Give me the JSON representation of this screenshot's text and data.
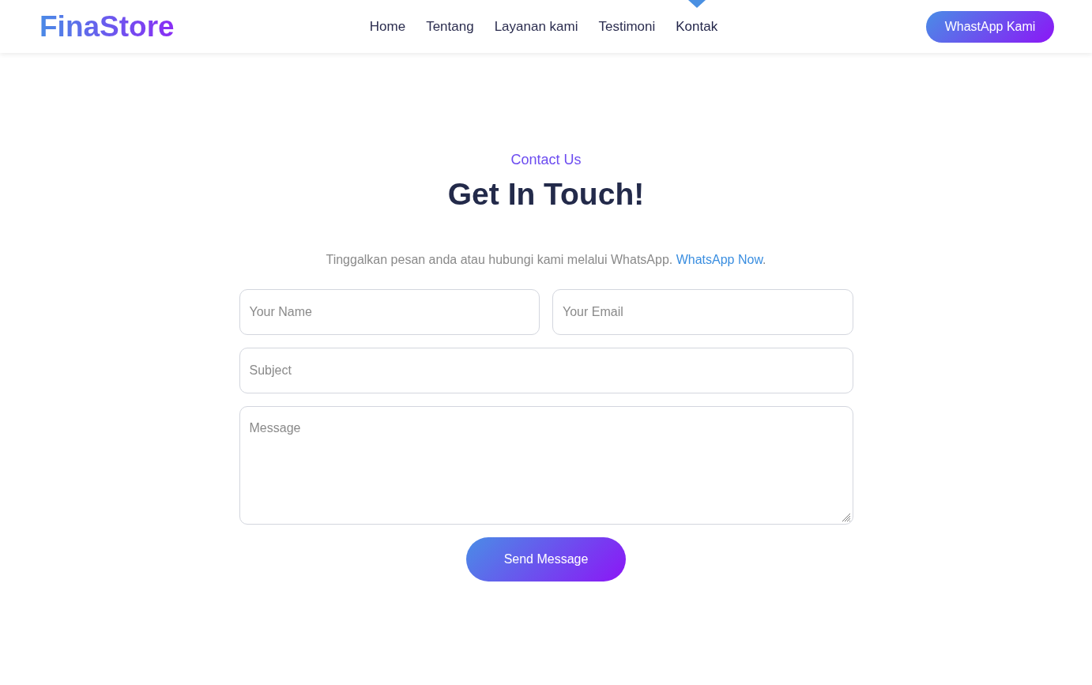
{
  "header": {
    "logo": "FinaStore",
    "nav": [
      {
        "label": "Home",
        "selected": false
      },
      {
        "label": "Tentang",
        "selected": false
      },
      {
        "label": "Layanan kami",
        "selected": false
      },
      {
        "label": "Testimoni",
        "selected": false
      },
      {
        "label": "Kontak",
        "selected": true
      }
    ],
    "cta_button": "WhastApp Kami"
  },
  "contact": {
    "eyebrow": "Contact Us",
    "title": "Get In Touch!",
    "intro": {
      "text": "Tinggalkan pesan anda atau hubungi kami melalui WhatsApp.",
      "link": "WhatsApp Now",
      "suffix": "."
    },
    "form": {
      "rows": [
        [
          {
            "kind": "input",
            "placeholder": "Your Name"
          },
          {
            "kind": "input",
            "placeholder": "Your Email"
          }
        ],
        [
          {
            "kind": "input",
            "placeholder": "Subject"
          }
        ],
        [
          {
            "kind": "textarea",
            "placeholder": "Message"
          }
        ]
      ],
      "submit": "Send Message"
    }
  }
}
